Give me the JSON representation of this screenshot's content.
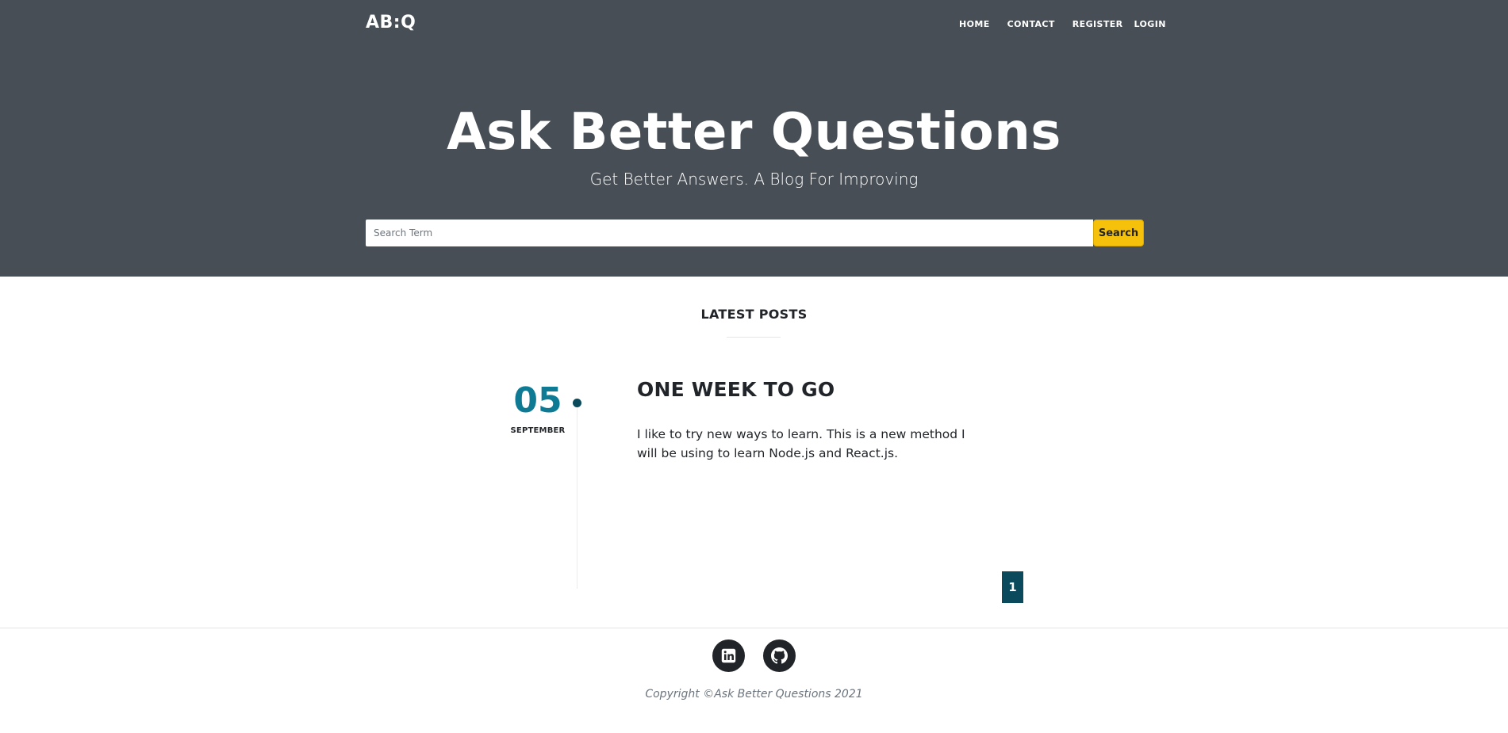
{
  "header": {
    "brand": "AB:Q",
    "nav": [
      {
        "label": "HOME"
      },
      {
        "label": "CONTACT"
      },
      {
        "label": "REGISTER"
      },
      {
        "label": "LOGIN"
      }
    ]
  },
  "hero": {
    "title": "Ask Better Questions",
    "subtitle": "Get Better Answers. A Blog For Improving",
    "search": {
      "placeholder": "Search Term",
      "value": "",
      "button_label": "Search"
    },
    "background_color": "#474e55"
  },
  "latest_posts": {
    "section_title": "LATEST POSTS",
    "posts": [
      {
        "day": "05",
        "month": "SEPTEMBER",
        "title": "ONE WEEK TO GO",
        "excerpt": "I like to try new ways to learn. This is a new method I will be using to learn Node.js and React.js."
      }
    ],
    "pagination": {
      "current_page": "1"
    }
  },
  "footer": {
    "social": [
      {
        "icon": "linkedin-icon"
      },
      {
        "icon": "github-icon"
      }
    ],
    "copyright": "Copyright ©Ask Better Questions 2021"
  },
  "colors": {
    "accent_teal": "#0e7a93",
    "search_button": "#f6c10a",
    "pagination_bg": "#0b4a5c"
  }
}
